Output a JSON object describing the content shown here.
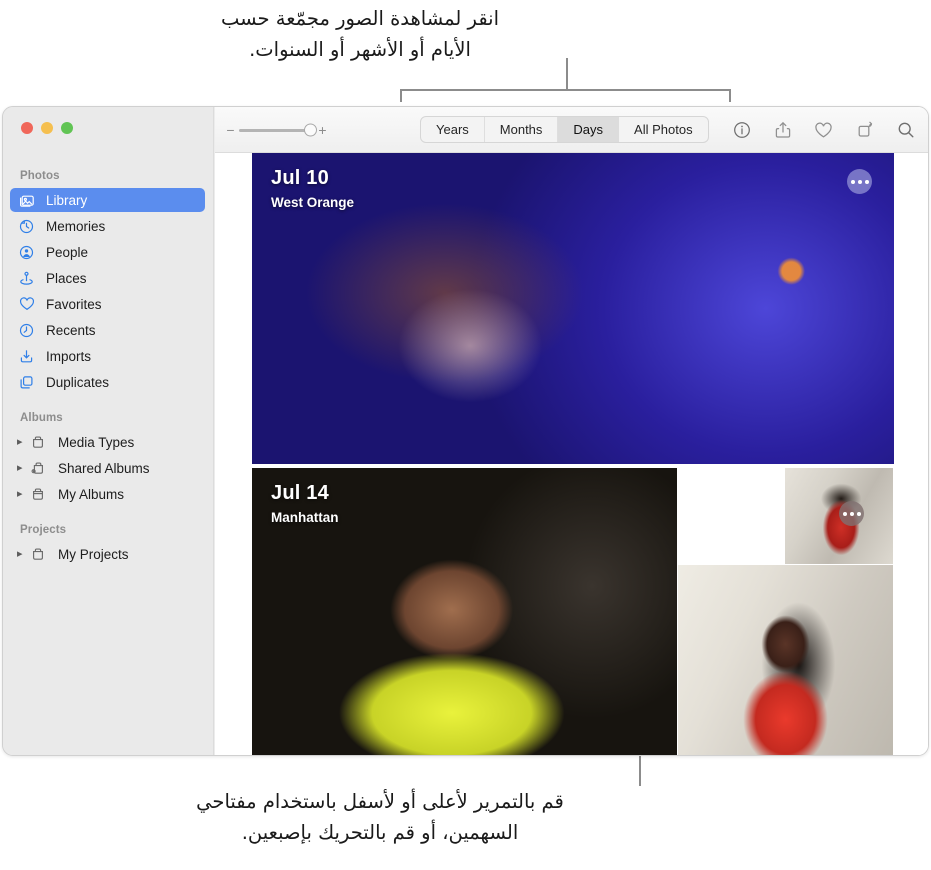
{
  "callouts": {
    "top": "انقر لمشاهدة الصور مجمّعة حسب\nالأيام أو الأشهر أو السنوات.",
    "bottom": "قم بالتمرير لأعلى أو لأسفل باستخدام مفتاحي\nالسهمين، أو قم بالتحريك بإصبعين."
  },
  "window": {
    "traffic_lights": [
      {
        "name": "close",
        "color": "#f0675a"
      },
      {
        "name": "minimize",
        "color": "#f5bf4f"
      },
      {
        "name": "zoom",
        "color": "#61c454"
      }
    ]
  },
  "sidebar": {
    "sections": [
      {
        "header": "Photos",
        "items": [
          {
            "label": "Library",
            "icon": "library-icon",
            "selected": true,
            "disclosure": false
          },
          {
            "label": "Memories",
            "icon": "memories-icon",
            "selected": false,
            "disclosure": false
          },
          {
            "label": "People",
            "icon": "people-icon",
            "selected": false,
            "disclosure": false
          },
          {
            "label": "Places",
            "icon": "places-icon",
            "selected": false,
            "disclosure": false
          },
          {
            "label": "Favorites",
            "icon": "heart-icon",
            "selected": false,
            "disclosure": false
          },
          {
            "label": "Recents",
            "icon": "clock-icon",
            "selected": false,
            "disclosure": false
          },
          {
            "label": "Imports",
            "icon": "import-icon",
            "selected": false,
            "disclosure": false
          },
          {
            "label": "Duplicates",
            "icon": "duplicates-icon",
            "selected": false,
            "disclosure": false
          }
        ]
      },
      {
        "header": "Albums",
        "items": [
          {
            "label": "Media Types",
            "icon": "folder-icon",
            "selected": false,
            "disclosure": true
          },
          {
            "label": "Shared Albums",
            "icon": "shared-folder-icon",
            "selected": false,
            "disclosure": true
          },
          {
            "label": "My Albums",
            "icon": "folder-icon",
            "selected": false,
            "disclosure": true
          }
        ]
      },
      {
        "header": "Projects",
        "items": [
          {
            "label": "My Projects",
            "icon": "folder-icon",
            "selected": false,
            "disclosure": true
          }
        ]
      }
    ],
    "selected_color": "#5b8dee"
  },
  "toolbar": {
    "zoom_slider": {
      "minus": "−",
      "plus": "+",
      "value": 92
    },
    "segments": [
      {
        "label": "Years",
        "active": false
      },
      {
        "label": "Months",
        "active": false
      },
      {
        "label": "Days",
        "active": true
      },
      {
        "label": "All Photos",
        "active": false
      }
    ],
    "icons": [
      {
        "name": "info-icon",
        "glyph": "info"
      },
      {
        "name": "share-icon",
        "glyph": "share"
      },
      {
        "name": "heart-icon",
        "glyph": "heart"
      },
      {
        "name": "rotate-icon",
        "glyph": "rotate"
      },
      {
        "name": "search-icon",
        "glyph": "search"
      }
    ]
  },
  "grid": {
    "days": [
      {
        "date": "Jul 10",
        "place": "West Orange",
        "more_button": true
      },
      {
        "date": "Jul 14",
        "place": "Manhattan",
        "more_button": true
      }
    ]
  }
}
